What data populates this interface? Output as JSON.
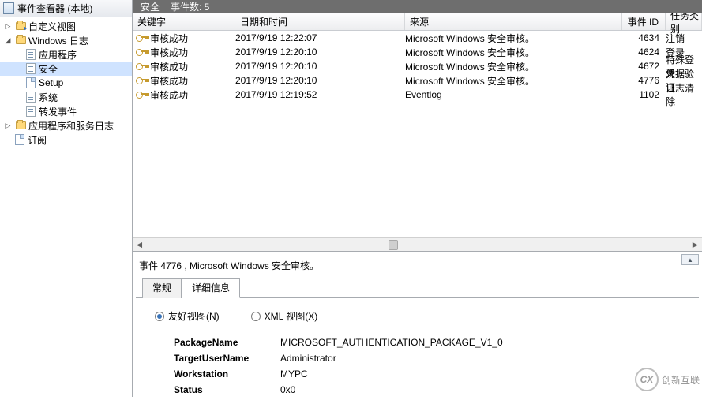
{
  "header": {
    "app_title": "事件查看器 (本地)"
  },
  "tree": {
    "custom_views": "自定义视图",
    "windows_logs": "Windows 日志",
    "application": "应用程序",
    "security": "安全",
    "setup": "Setup",
    "system": "系统",
    "forwarded": "转发事件",
    "app_services": "应用程序和服务日志",
    "subscriptions": "订阅"
  },
  "info_bar": {
    "label_security": "安全",
    "label_count": "事件数: 5"
  },
  "columns": {
    "keyword": "关键字",
    "datetime": "日期和时间",
    "source": "来源",
    "eventid": "事件 ID",
    "task": "任务类别"
  },
  "rows": [
    {
      "keyword": "审核成功",
      "datetime": "2017/9/19 12:22:07",
      "source": "Microsoft Windows 安全审核。",
      "id": "4634",
      "task": "注销"
    },
    {
      "keyword": "审核成功",
      "datetime": "2017/9/19 12:20:10",
      "source": "Microsoft Windows 安全审核。",
      "id": "4624",
      "task": "登录"
    },
    {
      "keyword": "审核成功",
      "datetime": "2017/9/19 12:20:10",
      "source": "Microsoft Windows 安全审核。",
      "id": "4672",
      "task": "特殊登录"
    },
    {
      "keyword": "审核成功",
      "datetime": "2017/9/19 12:20:10",
      "source": "Microsoft Windows 安全审核。",
      "id": "4776",
      "task": "凭据验证"
    },
    {
      "keyword": "审核成功",
      "datetime": "2017/9/19 12:19:52",
      "source": "Eventlog",
      "id": "1102",
      "task": "日志清除"
    }
  ],
  "detail": {
    "title": "事件 4776 , Microsoft Windows 安全审核。",
    "tab_general": "常规",
    "tab_details": "详细信息",
    "friendly_view": "友好视图(N)",
    "xml_view": "XML 视图(X)",
    "fields": {
      "package_name_label": "PackageName",
      "package_name_value": "MICROSOFT_AUTHENTICATION_PACKAGE_V1_0",
      "target_user_label": "TargetUserName",
      "target_user_value": "Administrator",
      "workstation_label": "Workstation",
      "workstation_value": "MYPC",
      "status_label": "Status",
      "status_value": "0x0"
    },
    "collapse": "▲"
  },
  "watermark": {
    "text": "创新互联",
    "initials": "CX"
  }
}
